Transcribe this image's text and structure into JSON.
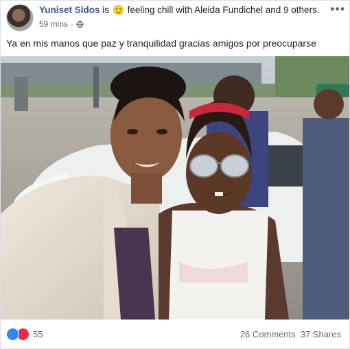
{
  "post": {
    "author": "Yuniset Sidos",
    "is_text": "is",
    "feeling_emoji": "relieved-face",
    "feeling_text": "feeling chill with",
    "tagged_person": "Aleida Fundichel",
    "and_text": "and",
    "others_link": "9 others.",
    "timestamp": "59 mins",
    "separator": "·",
    "privacy_icon": "globe-icon",
    "more_icon": "more-options-icon",
    "message": "Ya en mis manos que paz y tranquilidad gracias amigos por preocuparse"
  },
  "photo": {
    "content_icon": "selfie-photo"
  },
  "footer": {
    "reaction_icons": [
      "like-icon",
      "love-icon"
    ],
    "reaction_count": "55",
    "comments": "26 Comments",
    "shares": "37 Shares"
  },
  "colors": {
    "link": "#385898",
    "secondary_text": "#616770",
    "like_blue": "#2d88ff",
    "love_red": "#f0284a"
  }
}
